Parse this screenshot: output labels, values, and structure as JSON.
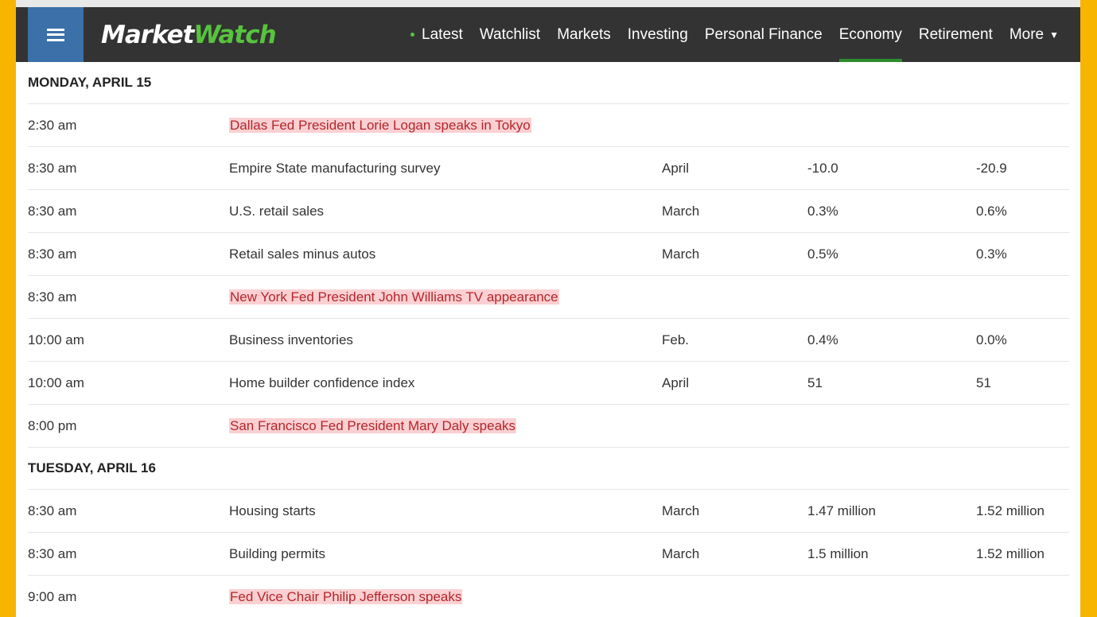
{
  "header": {
    "logo_part1": "Market",
    "logo_part2": "Watch",
    "nav": [
      {
        "label": "Latest"
      },
      {
        "label": "Watchlist"
      },
      {
        "label": "Markets"
      },
      {
        "label": "Investing"
      },
      {
        "label": "Personal Finance"
      },
      {
        "label": "Economy"
      },
      {
        "label": "Retirement"
      },
      {
        "label": "More"
      }
    ],
    "active_tab": "Economy"
  },
  "colors": {
    "accent_green": "#57c33e",
    "nav_bg": "#333333",
    "menu_blue": "#3b70a9",
    "frame_yellow": "#f7b500",
    "highlight_bg": "#fbd0d2",
    "highlight_text": "#b3262b"
  },
  "days": [
    {
      "label": "MONDAY, APRIL 15",
      "rows": [
        {
          "time": "2:30 am",
          "event": "Dallas Fed President Lorie Logan speaks in Tokyo",
          "period": "",
          "forecast": "",
          "previous": "",
          "fed_speaker": true
        },
        {
          "time": "8:30 am",
          "event": "Empire State manufacturing survey",
          "period": "April",
          "forecast": "-10.0",
          "previous": "-20.9",
          "fed_speaker": false
        },
        {
          "time": "8:30 am",
          "event": "U.S. retail sales",
          "period": "March",
          "forecast": "0.3%",
          "previous": "0.6%",
          "fed_speaker": false
        },
        {
          "time": "8:30 am",
          "event": "Retail sales minus autos",
          "period": "March",
          "forecast": "0.5%",
          "previous": "0.3%",
          "fed_speaker": false
        },
        {
          "time": "8:30 am",
          "event": "New York Fed President John Williams TV appearance",
          "period": "",
          "forecast": "",
          "previous": "",
          "fed_speaker": true
        },
        {
          "time": "10:00 am",
          "event": "Business inventories",
          "period": "Feb.",
          "forecast": "0.4%",
          "previous": "0.0%",
          "fed_speaker": false
        },
        {
          "time": "10:00 am",
          "event": "Home builder confidence index",
          "period": "April",
          "forecast": "51",
          "previous": "51",
          "fed_speaker": false
        },
        {
          "time": "8:00 pm",
          "event": "San Francisco Fed President Mary Daly speaks",
          "period": "",
          "forecast": "",
          "previous": "",
          "fed_speaker": true
        }
      ]
    },
    {
      "label": "TUESDAY, APRIL 16",
      "rows": [
        {
          "time": "8:30 am",
          "event": "Housing starts",
          "period": "March",
          "forecast": "1.47 million",
          "previous": "1.52 million",
          "fed_speaker": false
        },
        {
          "time": "8:30 am",
          "event": "Building permits",
          "period": "March",
          "forecast": "1.5 million",
          "previous": "1.52 million",
          "fed_speaker": false
        },
        {
          "time": "9:00 am",
          "event": "Fed Vice Chair Philip Jefferson speaks",
          "period": "",
          "forecast": "",
          "previous": "",
          "fed_speaker": true
        }
      ]
    }
  ]
}
